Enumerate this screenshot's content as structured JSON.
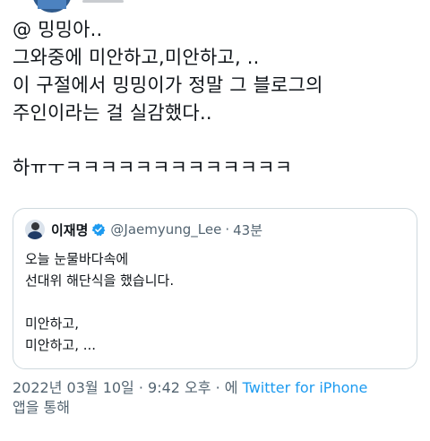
{
  "tweet": {
    "lines": [
      "@ 밍밍아..",
      "그와중에 미안하고,미안하고, ..",
      "이 구절에서 밍밍이가 정말 그 블로그의",
      "주인이라는 걸 실감했다.."
    ],
    "laugh_line": "하ㅠㅜㅋㅋㅋㅋㅋㅋㅋㅋㅋㅋㅋㅋㅋ"
  },
  "quote": {
    "name": "이재명",
    "handle": "@Jaemyung_Lee",
    "separator": "·",
    "time": "43분",
    "lines_top": [
      "오늘 눈물바다속에",
      "선대위 해단식을 했습니다."
    ],
    "lines_bottom": [
      "미안하고,",
      "미안하고, ..."
    ]
  },
  "meta": {
    "timestamp": "2022년 03월 10일 · 9:42 오후 · 에",
    "source": "Twitter for iPhone",
    "suffix": "앱을 통해"
  },
  "colors": {
    "text": "#0f1419",
    "secondary": "#536471",
    "accent": "#1d9bf0",
    "border": "#cfd9de"
  }
}
